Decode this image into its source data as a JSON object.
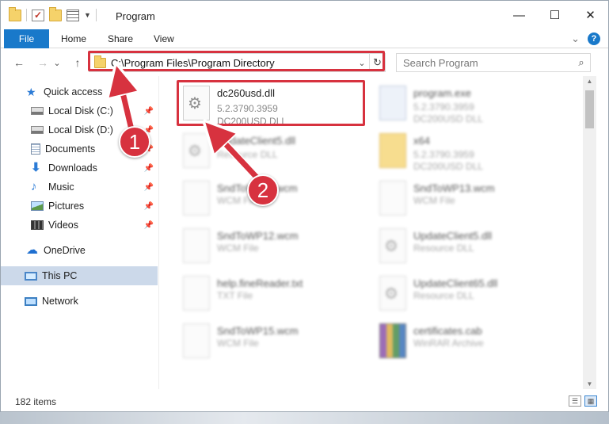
{
  "window": {
    "title": "Program",
    "minimize_glyph": "—",
    "maximize_glyph": "☐",
    "close_glyph": "✕"
  },
  "ribbon": {
    "tabs": [
      "File",
      "Home",
      "Share",
      "View"
    ],
    "collapse_glyph": "⌄",
    "help_glyph": "?"
  },
  "nav": {
    "back_glyph": "←",
    "forward_glyph": "→",
    "dropdown_glyph": "⌄",
    "up_glyph": "↑",
    "address": "C:\\Program Files\\Program Directory",
    "address_drop_glyph": "⌄",
    "refresh_glyph": "↻",
    "search_placeholder": "Search Program",
    "search_glyph": "⌕"
  },
  "sidebar": {
    "items": [
      {
        "label": "Quick access",
        "icon": "star-icon",
        "pinned": false
      },
      {
        "label": "Local Disk (C:)",
        "icon": "drive-icon",
        "pinned": true
      },
      {
        "label": "Local Disk (D:)",
        "icon": "drive-icon",
        "pinned": true
      },
      {
        "label": "Documents",
        "icon": "documents-icon",
        "pinned": true
      },
      {
        "label": "Downloads",
        "icon": "download-icon",
        "pinned": true
      },
      {
        "label": "Music",
        "icon": "music-icon",
        "pinned": true
      },
      {
        "label": "Pictures",
        "icon": "pictures-icon",
        "pinned": true
      },
      {
        "label": "Videos",
        "icon": "videos-icon",
        "pinned": true
      },
      {
        "label": "OneDrive",
        "icon": "cloud-icon",
        "pinned": false
      },
      {
        "label": "This PC",
        "icon": "computer-icon",
        "pinned": false,
        "selected": true
      },
      {
        "label": "Network",
        "icon": "network-icon",
        "pinned": false
      }
    ]
  },
  "files": [
    {
      "name": "dc260usd.dll",
      "line1": "5.2.3790.3959",
      "line2": "DC200USD DLL",
      "icon": "dll-gear-icon"
    },
    {
      "name": "program.exe",
      "line1": "5.2.3790.3959",
      "line2": "DC200USD DLL",
      "icon": "exe-icon"
    },
    {
      "name": "UpdateClient5.dll",
      "line1": "Resource DLL",
      "line2": "",
      "icon": "dll-gear-icon"
    },
    {
      "name": "x64",
      "line1": "5.2.3790.3959",
      "line2": "DC200USD DLL",
      "icon": "folder-icon"
    },
    {
      "name": "SndToWP11.wcm",
      "line1": "WCM File",
      "line2": "",
      "icon": "file-icon"
    },
    {
      "name": "SndToWP13.wcm",
      "line1": "WCM File",
      "line2": "",
      "icon": "file-icon"
    },
    {
      "name": "SndToWP12.wcm",
      "line1": "WCM File",
      "line2": "",
      "icon": "file-icon"
    },
    {
      "name": "UpdateClient5.dll",
      "line1": "Resource DLL",
      "line2": "",
      "icon": "dll-gear-icon"
    },
    {
      "name": "help.fineReader.txt",
      "line1": "TXT File",
      "line2": "",
      "icon": "file-icon"
    },
    {
      "name": "UpdateClient65.dll",
      "line1": "Resource DLL",
      "line2": "",
      "icon": "dll-gear-icon"
    },
    {
      "name": "SndToWP15.wcm",
      "line1": "WCM File",
      "line2": "",
      "icon": "file-icon"
    },
    {
      "name": "certificates.cab",
      "line1": "WinRAR Archive",
      "line2": "",
      "icon": "rar-icon"
    }
  ],
  "status": {
    "items_count": "182 items"
  },
  "annotations": {
    "badge1": "1",
    "badge2": "2",
    "color": "#d7323f"
  }
}
